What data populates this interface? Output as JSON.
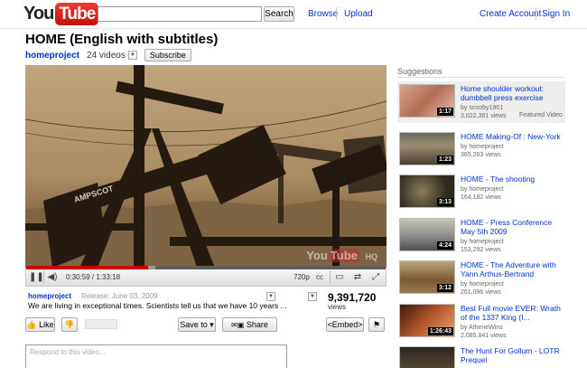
{
  "header": {
    "logo_you": "You",
    "logo_tube": "Tube",
    "search_button": "Search",
    "browse": "Browse",
    "upload": "Upload",
    "create_account": "Create Account",
    "sign_in": "Sign In"
  },
  "video": {
    "title": "HOME (English with subtitles)",
    "channel": "homeproject",
    "video_count": "24 videos",
    "subscribe": "Subscribe",
    "watermark_you": "You",
    "watermark_tube": "Tube",
    "watermark_suffix": "HQ",
    "progress_played": 0.34,
    "progress_loaded": 0.36,
    "time": "0:30:59 / 1:33:18",
    "quality": "720p"
  },
  "info": {
    "owner": "homeproject",
    "release": "Release: June 03, 2009",
    "description": "We are living in exceptional times. Scientists tell us that we have 10 years ...",
    "views_count": "9,391,720",
    "views_label": "views"
  },
  "actions": {
    "like": "Like",
    "save_to": "Save to",
    "share": "Share",
    "embed": "<Embed>"
  },
  "comment": {
    "placeholder": "Respond to this video..."
  },
  "suggestions": {
    "header": "Suggestions",
    "items": [
      {
        "title": "Home shoulder workout: dumbbell press exercise",
        "by": "by scooby1961",
        "views": "3,022,381 views",
        "duration": "1:17",
        "featured": "Featured Video"
      },
      {
        "title": "HOME Making-Of : New-York",
        "by": "by homeproject",
        "views": "365,263 views",
        "duration": "1:23"
      },
      {
        "title": "HOME - The shooting",
        "by": "by homeproject",
        "views": "164,182 views",
        "duration": "3:13"
      },
      {
        "title": "HOME - Press Conference May 5th 2009",
        "by": "by homeproject",
        "views": "153,292 views",
        "duration": "4:24"
      },
      {
        "title": "HOME - The Adventure with Yann Arthus-Bertrand",
        "by": "by homeproject",
        "views": "261,096 views",
        "duration": "3:12"
      },
      {
        "title": "Best Full movie EVER: Wrath of the 1337 King (I...",
        "by": "by AtheneWins",
        "views": "2,085,841 views",
        "duration": "1:26:43"
      },
      {
        "title": "The Hunt For Gollum - LOTR Prequel",
        "by": "",
        "views": "",
        "duration": ""
      }
    ]
  },
  "colors": {
    "link": "#0033cc",
    "brand_red": "#d8221e",
    "progress_red": "#cc0000"
  }
}
